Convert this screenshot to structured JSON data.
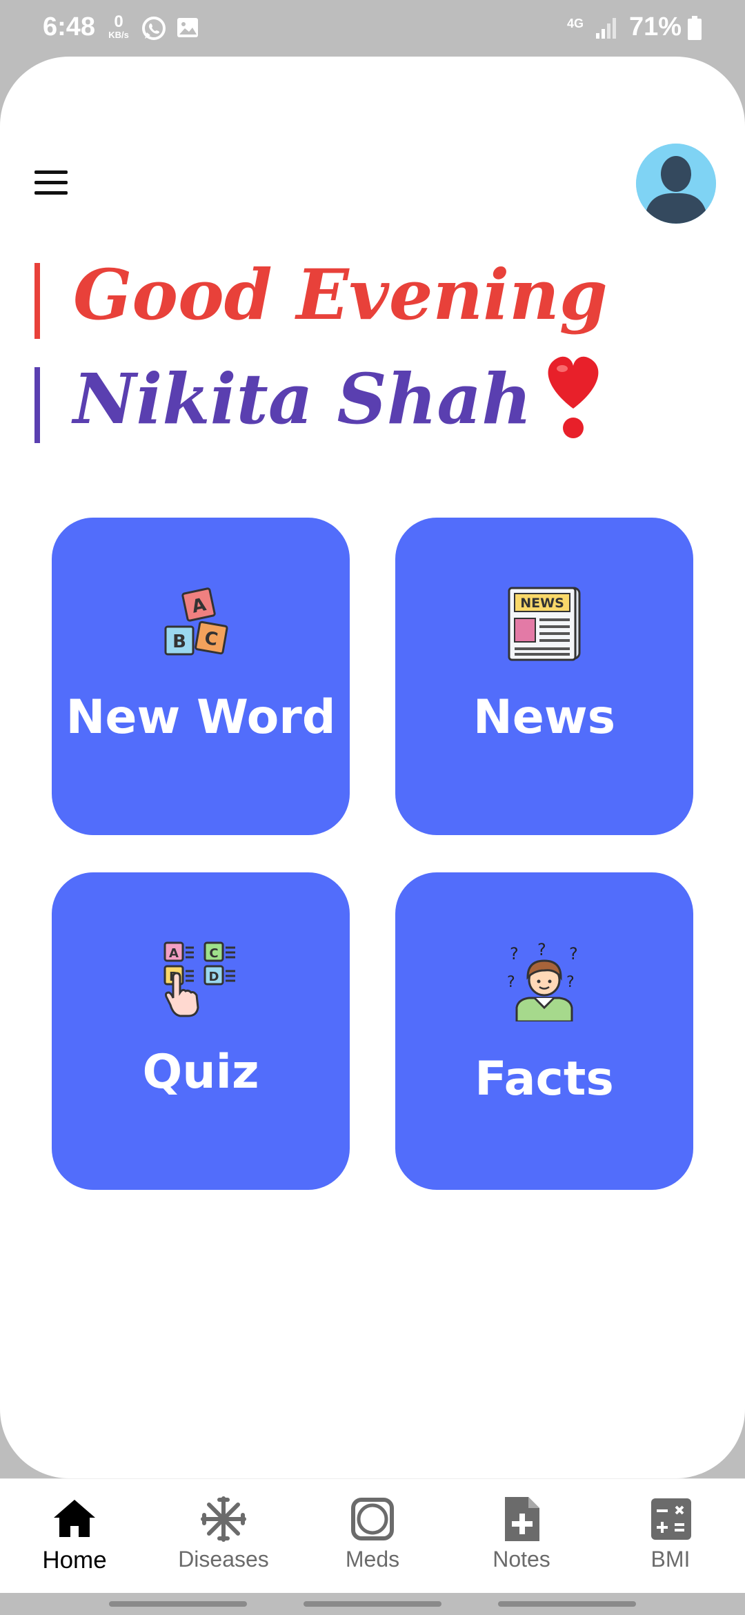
{
  "status_bar": {
    "time": "6:48",
    "net_speed_value": "0",
    "net_speed_unit": "KB/s",
    "network": "4G",
    "battery": "71%"
  },
  "header": {
    "menu_icon": "hamburger-icon",
    "avatar_icon": "user-silhouette-icon"
  },
  "greeting": {
    "line1": "Good Evening",
    "line2": "Nikita Shah",
    "emoji_icon": "heart-exclamation-icon",
    "colors": {
      "line1": "#e8413a",
      "line2": "#5a3fb0"
    }
  },
  "tiles": [
    {
      "label": "New Word",
      "icon": "abc-blocks-icon"
    },
    {
      "label": "News",
      "icon": "newspaper-icon"
    },
    {
      "label": "Quiz",
      "icon": "quiz-options-icon"
    },
    {
      "label": "Facts",
      "icon": "thinking-person-icon"
    }
  ],
  "tile_color": "#526dfb",
  "newspaper_text": "NEWS",
  "quiz_letters": [
    "A",
    "C",
    "B",
    "D"
  ],
  "blocks_letters": [
    "A",
    "B",
    "C"
  ],
  "bottom_nav": {
    "active": "Home",
    "items": [
      {
        "label": "Home",
        "icon": "home-icon"
      },
      {
        "label": "Diseases",
        "icon": "virus-icon"
      },
      {
        "label": "Meds",
        "icon": "pill-icon"
      },
      {
        "label": "Notes",
        "icon": "add-note-icon"
      },
      {
        "label": "BMI",
        "icon": "calculator-icon"
      }
    ]
  }
}
